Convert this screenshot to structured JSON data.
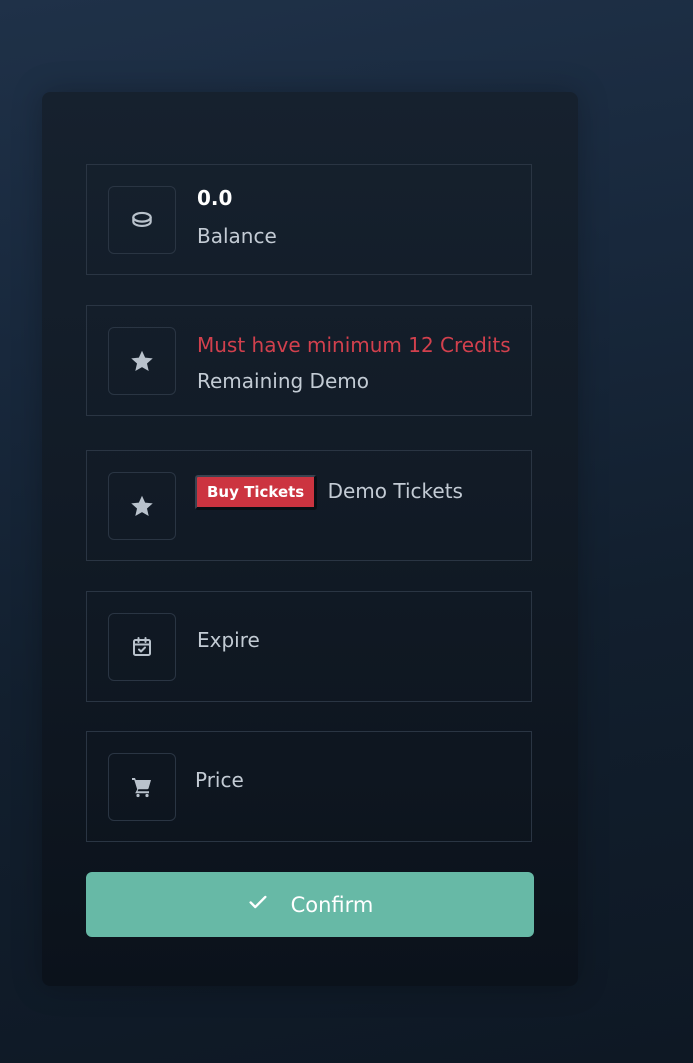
{
  "balance": {
    "icon": "coins-icon",
    "value": "0.0",
    "label": "Balance"
  },
  "credits": {
    "icon": "star-icon",
    "warning": "Must have minimum 12 Credits",
    "label": "Remaining Demo"
  },
  "tickets": {
    "icon": "star-icon",
    "buy_label": "Buy Tickets",
    "label": "Demo Tickets"
  },
  "expire": {
    "icon": "calendar-check-icon",
    "label": "Expire"
  },
  "price": {
    "icon": "cart-icon",
    "label": "Price"
  },
  "confirm": {
    "icon": "check-icon",
    "label": "Confirm"
  },
  "colors": {
    "accent": "#67b9a6",
    "warning": "#d2404d",
    "buy_button": "#cc3440"
  }
}
